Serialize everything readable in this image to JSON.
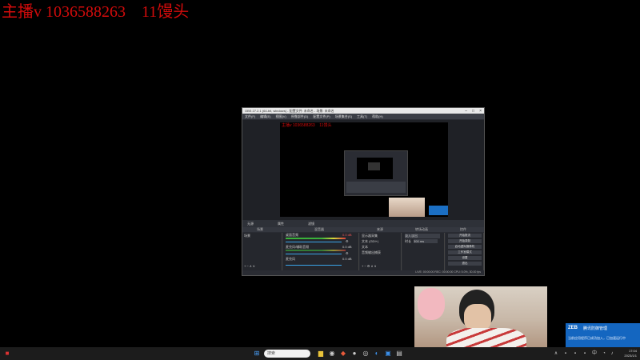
{
  "overlay": {
    "title": "主播v 1036588263    11馒头"
  },
  "obs": {
    "window_title": "OBS 27.2.1 (64-bit, windows) - 配置文件: 未命名 - 场景: 未命名",
    "menu": [
      "文件(F)",
      "编辑(E)",
      "视图(V)",
      "停靠部件(D)",
      "配置文件(P)",
      "场景集合(S)",
      "工具(T)",
      "帮助(H)"
    ],
    "preview_title": "主播v 1036588263    11馒头",
    "scene_toolbar": {
      "label": "无源",
      "properties": "属性",
      "filters": "滤镜"
    },
    "dock_headers": [
      "场景",
      "混音器",
      "来源",
      "转场动画",
      "控件"
    ],
    "scenes": [
      "场景"
    ],
    "mixer": [
      {
        "name": "桌面音频",
        "db": "0.0 dB"
      },
      {
        "name": "麦克风/辅助音频",
        "db": "0.0 dB"
      },
      {
        "name": "麦克风",
        "db": "0.0 dB"
      }
    ],
    "sources": [
      "显示器采集",
      "文本 (GDI+)",
      "文本",
      "音频输出捕获"
    ],
    "transitions": {
      "type": "淡入淡出",
      "duration_label": "时长",
      "duration": "300 ms"
    },
    "controls": [
      "开始推流",
      "开始录制",
      "启动虚拟摄像机",
      "工作室模式",
      "设置",
      "退出"
    ],
    "status": "LIVE: 00:00:00   REC: 00:00:00   CPU: 5.0%, 30.00 fps"
  },
  "notification": {
    "logo": "ZEB",
    "title": "腾讯防御管理",
    "body": "当前应用程序已成功加入，已加速运行中"
  },
  "taskbar": {
    "search_placeholder": "搜索",
    "time": "17:04",
    "date": "2023/1/1"
  }
}
